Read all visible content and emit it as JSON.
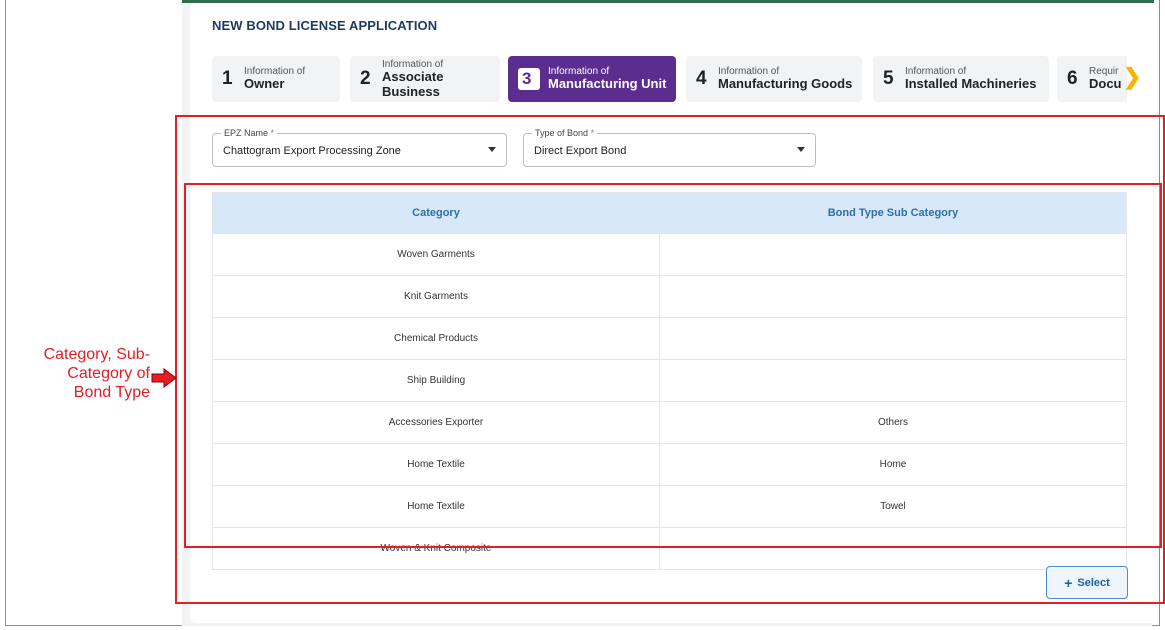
{
  "app": {
    "title": "NEW BOND LICENSE APPLICATION"
  },
  "steps": [
    {
      "num": "1",
      "small": "Information of",
      "big": "Owner"
    },
    {
      "num": "2",
      "small": "Information of",
      "big": "Associate Business"
    },
    {
      "num": "3",
      "small": "Information of",
      "big": "Manufacturing Unit",
      "active": true
    },
    {
      "num": "4",
      "small": "Information of",
      "big": "Manufacturing Goods"
    },
    {
      "num": "5",
      "small": "Information of",
      "big": "Installed Machineries"
    },
    {
      "num": "6",
      "small": "Requir",
      "big": "Docu"
    }
  ],
  "form": {
    "epz": {
      "label": "EPZ Name",
      "required_mark": "*",
      "value": "Chattogram Export Processing Zone"
    },
    "bond_type": {
      "label": "Type of Bond",
      "required_mark": "*",
      "value": "Direct Export Bond"
    }
  },
  "table": {
    "headers": [
      "Category",
      "Bond Type Sub Category"
    ],
    "rows": [
      [
        "Woven Garments",
        ""
      ],
      [
        "Knit Garments",
        ""
      ],
      [
        "Chemical Products",
        ""
      ],
      [
        "Ship Building",
        ""
      ],
      [
        "Accessories Exporter",
        "Others"
      ],
      [
        "Home Textile",
        "Home"
      ],
      [
        "Home Textile",
        "Towel"
      ],
      [
        "Woven & Knit Composite",
        ""
      ]
    ]
  },
  "actions": {
    "select_label": "Select"
  },
  "annotation": {
    "lines": [
      "Category, Sub-",
      "Category of",
      "Bond Type"
    ],
    "color": "#e31e24"
  },
  "colors": {
    "active_step": "#5b2d8e",
    "table_header_bg": "#d7e9f8",
    "table_header_text": "#2f6ea8",
    "annotation_red": "#e31e24"
  },
  "icons": {
    "next_steps": "chevron-right-icon",
    "dropdown": "chevron-down-icon",
    "select": "plus-icon",
    "callout": "red-arrow-right-icon"
  }
}
